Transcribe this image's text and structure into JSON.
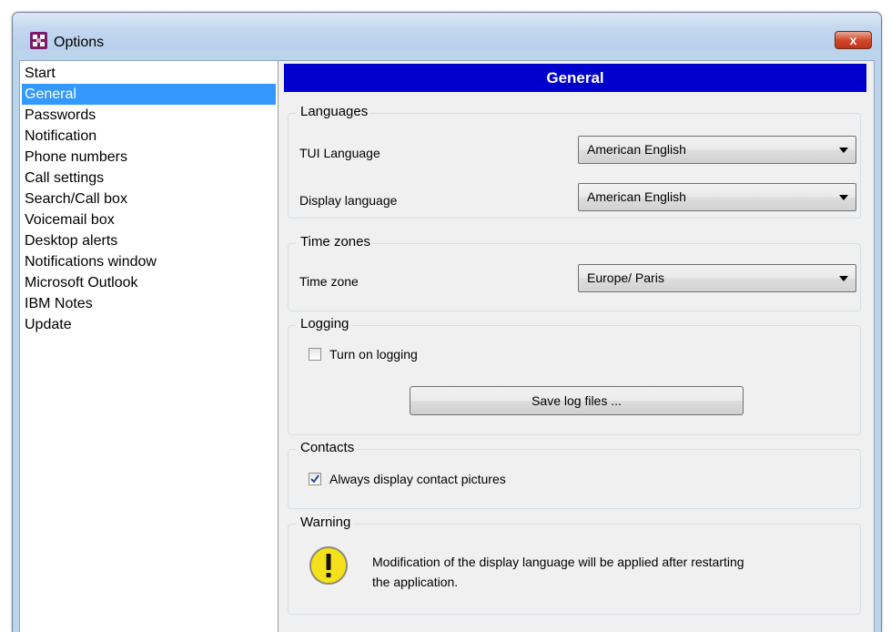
{
  "window": {
    "title": "Options",
    "close_glyph": "x"
  },
  "sidebar": {
    "selected_index": 1,
    "items": [
      {
        "label": "Start"
      },
      {
        "label": "General"
      },
      {
        "label": "Passwords"
      },
      {
        "label": "Notification"
      },
      {
        "label": "Phone numbers"
      },
      {
        "label": "Call settings"
      },
      {
        "label": "Search/Call box"
      },
      {
        "label": "Voicemail box"
      },
      {
        "label": "Desktop alerts"
      },
      {
        "label": "Notifications window"
      },
      {
        "label": "Microsoft Outlook"
      },
      {
        "label": "IBM Notes"
      },
      {
        "label": "Update"
      }
    ]
  },
  "page": {
    "header": "General",
    "languages": {
      "legend": "Languages",
      "tui_label": "TUI Language",
      "tui_value": "American English",
      "display_label": "Display language",
      "display_value": "American English"
    },
    "timezones": {
      "legend": "Time zones",
      "zone_label": "Time zone",
      "zone_value": "Europe/ Paris"
    },
    "logging": {
      "legend": "Logging",
      "checkbox_label": "Turn on logging",
      "checked": false,
      "save_button": "Save log files ..."
    },
    "contacts": {
      "legend": "Contacts",
      "checkbox_label": "Always display contact pictures",
      "checked": true
    },
    "warning": {
      "legend": "Warning",
      "icon": "warning-icon",
      "line1": "Modification of the display language will be applied after restarting",
      "line2": "the application."
    }
  },
  "colors": {
    "header_bg": "#0000cc",
    "selection_bg": "#3399ff",
    "close_button": "#c9442a"
  }
}
